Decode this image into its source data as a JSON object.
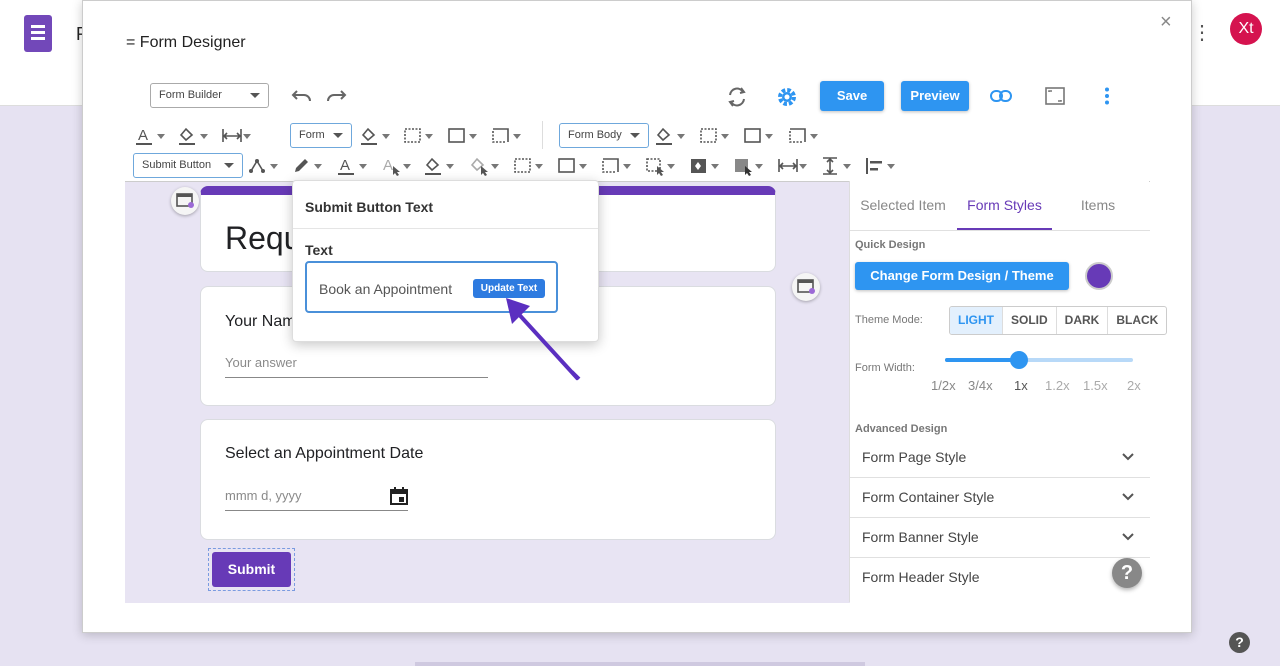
{
  "background": {
    "doc_initial": "R",
    "avatar": "Xt",
    "help": "?"
  },
  "dialog": {
    "title": "= Form Designer",
    "close": "×"
  },
  "toolbar": {
    "mode_select": "Form Builder",
    "save_label": "Save",
    "preview_label": "Preview",
    "form_select": "Form",
    "form_body_select": "Form Body",
    "submit_select": "Submit Button"
  },
  "form": {
    "title": "Requ",
    "questions": [
      {
        "label": "Your Nam",
        "placeholder": "Your answer"
      },
      {
        "label": "Select an Appointment Date",
        "placeholder": "mmm d, yyyy"
      }
    ],
    "submit_label": "Submit"
  },
  "popup": {
    "title": "Submit Button Text",
    "field_label": "Text",
    "field_value": "Book an Appointment",
    "update_label": "Update Text"
  },
  "panel": {
    "tabs": [
      {
        "label": "Selected Item",
        "active": false
      },
      {
        "label": "Form Styles",
        "active": true
      },
      {
        "label": "Items",
        "active": false
      }
    ],
    "quick_design": "Quick Design",
    "theme_button": "Change Form Design / Theme",
    "swatch_color": "#673ab7",
    "theme_mode_label": "Theme Mode:",
    "theme_modes": [
      "LIGHT",
      "SOLID",
      "DARK",
      "BLACK"
    ],
    "selected_mode": "LIGHT",
    "form_width_label": "Form Width:",
    "width_ticks": [
      "1/2x",
      "3/4x",
      "1x",
      "1.2x",
      "1.5x",
      "2x"
    ],
    "width_value": "1x",
    "advanced_design": "Advanced Design",
    "accordions": [
      "Form Page Style",
      "Form Container Style",
      "Form Banner Style",
      "Form Header Style"
    ]
  },
  "colors": {
    "accent": "#673ab7",
    "primary_button": "#2e95f1"
  }
}
